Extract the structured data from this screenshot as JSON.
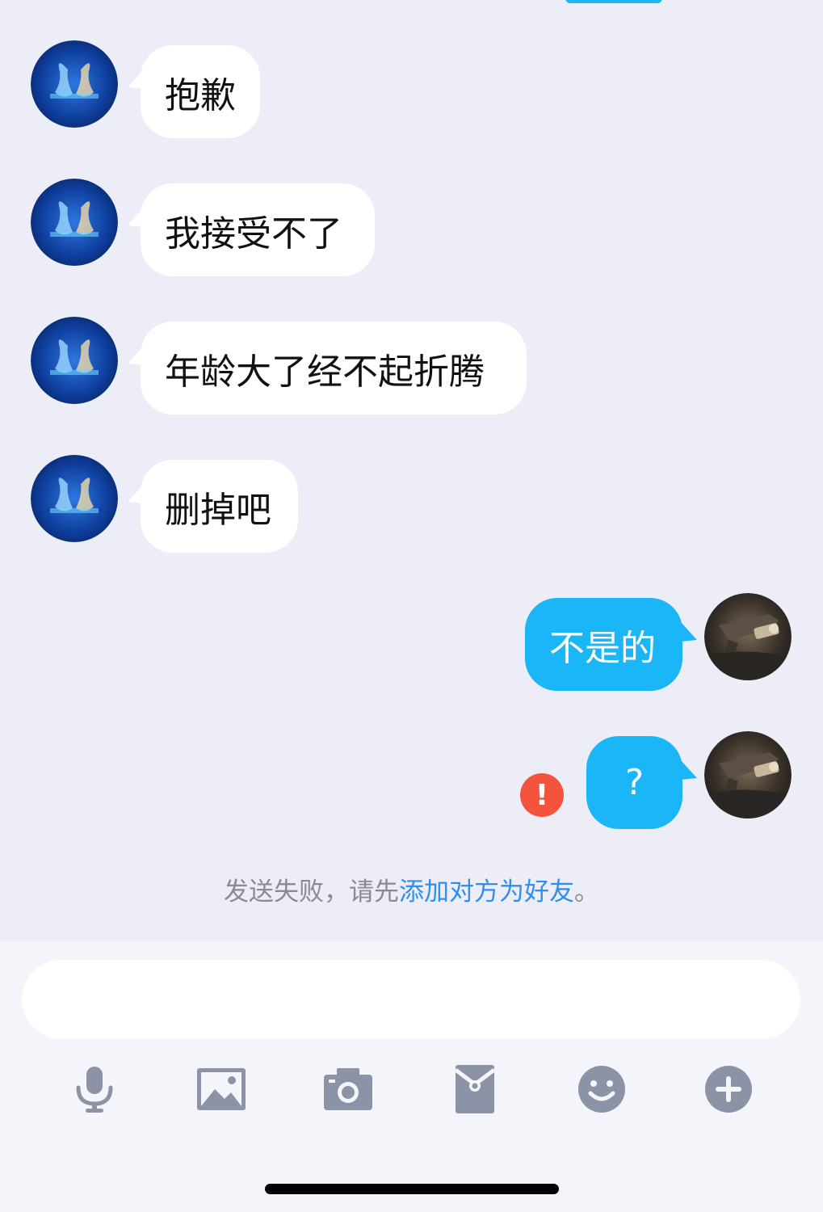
{
  "conversation": {
    "incoming": [
      {
        "text": "抱歉",
        "avatar": "swan-crystal-avatar"
      },
      {
        "text": "我接受不了",
        "avatar": "swan-crystal-avatar"
      },
      {
        "text": "年龄大了经不起折腾",
        "avatar": "swan-crystal-avatar"
      },
      {
        "text": "删掉吧",
        "avatar": "swan-crystal-avatar"
      }
    ],
    "outgoing": [
      {
        "text": "不是的",
        "avatar": "rifle-avatar"
      },
      {
        "text": "?",
        "avatar": "rifle-avatar",
        "status": "failed"
      }
    ]
  },
  "error_icon_glyph": "!",
  "notice": {
    "prefix": "发送失败，请先",
    "link": "添加对方为好友",
    "suffix": "。"
  },
  "input": {
    "value": "",
    "placeholder": ""
  },
  "toolbar": {
    "icons": [
      "microphone-icon",
      "image-icon",
      "camera-icon",
      "red-packet-icon",
      "emoji-icon",
      "plus-icon"
    ]
  },
  "colors": {
    "background": "#ecedf7",
    "incoming_bubble": "#ffffff",
    "outgoing_bubble": "#1ab6f8",
    "error": "#f4543e",
    "link": "#2f8ff0",
    "toolbar_icon": "#8d93a6"
  }
}
